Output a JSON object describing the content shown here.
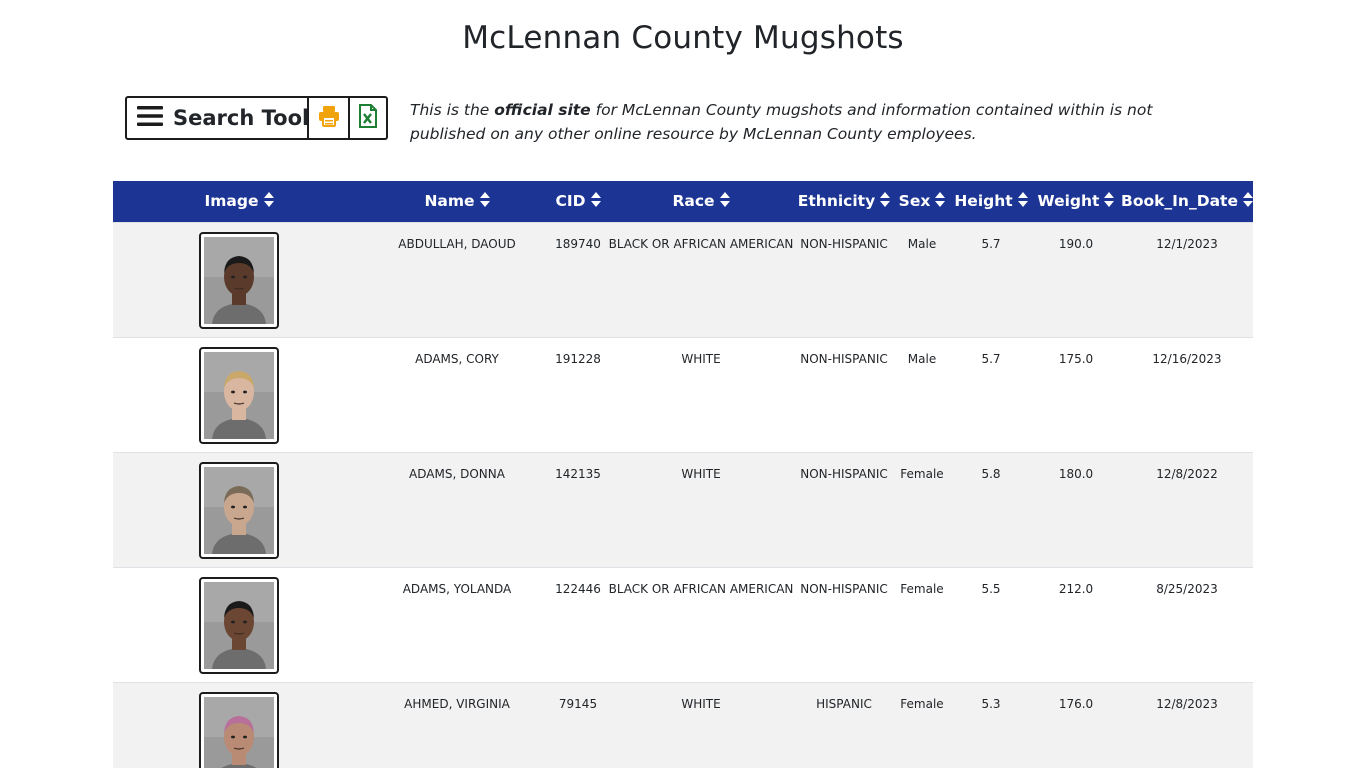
{
  "page": {
    "title": "McLennan County Mugshots"
  },
  "toolbar": {
    "search_label": "Search Tools",
    "menu_icon": "hamburger-icon",
    "print_icon": "printer-icon",
    "excel_icon": "excel-file-icon",
    "colors": {
      "print": "#f0a30a",
      "excel": "#1e7e34"
    }
  },
  "notice": {
    "prefix": "This is the ",
    "emphasis": "official site",
    "suffix": " for McLennan County mugshots and information contained within is not published on any other online resource by McLennan County employees."
  },
  "table": {
    "header_color": "#1c3494",
    "columns": [
      "Image",
      "Name",
      "CID",
      "Race",
      "Ethnicity",
      "Sex",
      "Height",
      "Weight",
      "Book_In_Date"
    ],
    "rows": [
      {
        "name": "ABDULLAH, DAOUD",
        "cid": "189740",
        "race": "BLACK OR AFRICAN AMERICAN",
        "ethnicity": "NON-HISPANIC",
        "sex": "Male",
        "height": "5.7",
        "weight": "190.0",
        "book_in_date": "12/1/2023"
      },
      {
        "name": "ADAMS, CORY",
        "cid": "191228",
        "race": "WHITE",
        "ethnicity": "NON-HISPANIC",
        "sex": "Male",
        "height": "5.7",
        "weight": "175.0",
        "book_in_date": "12/16/2023"
      },
      {
        "name": "ADAMS, DONNA",
        "cid": "142135",
        "race": "WHITE",
        "ethnicity": "NON-HISPANIC",
        "sex": "Female",
        "height": "5.8",
        "weight": "180.0",
        "book_in_date": "12/8/2022"
      },
      {
        "name": "ADAMS, YOLANDA",
        "cid": "122446",
        "race": "BLACK OR AFRICAN AMERICAN",
        "ethnicity": "NON-HISPANIC",
        "sex": "Female",
        "height": "5.5",
        "weight": "212.0",
        "book_in_date": "8/25/2023"
      },
      {
        "name": "AHMED, VIRGINIA",
        "cid": "79145",
        "race": "WHITE",
        "ethnicity": "HISPANIC",
        "sex": "Female",
        "height": "5.3",
        "weight": "176.0",
        "book_in_date": "12/8/2023"
      }
    ]
  }
}
